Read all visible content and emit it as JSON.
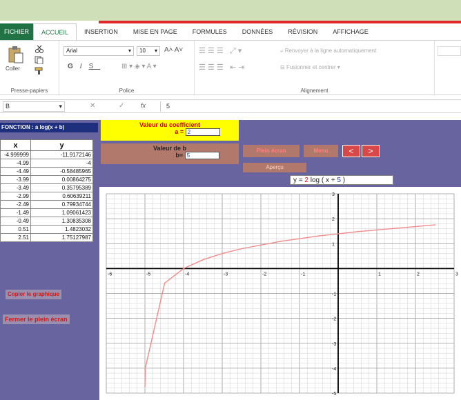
{
  "ribbon": {
    "tabs": [
      "FICHIER",
      "ACCUEIL",
      "INSERTION",
      "MISE EN PAGE",
      "FORMULES",
      "DONNÉES",
      "RÉVISION",
      "AFFICHAGE"
    ],
    "paste_label": "Coller",
    "clipboard_label": "Presse-papiers",
    "font_name": "Arial",
    "font_size": "10",
    "bold": "G",
    "italic": "I",
    "underline": "S",
    "police_label": "Police",
    "wrap_text": "Renvoyer à la ligne automatiquement",
    "merge_center": "Fusionner et centrer",
    "alignment_label": "Alignement"
  },
  "formula_bar": {
    "name_box": "B",
    "fx": "fx",
    "value": "5"
  },
  "sheet": {
    "function_label": "FONCTION : a log(x + b)",
    "table": {
      "headers": [
        "x",
        "y"
      ],
      "rows": [
        [
          "-4.999999",
          "-11.9172146"
        ],
        [
          "-4.99",
          "-4"
        ],
        [
          "-4.49",
          "-0.58485965"
        ],
        [
          "-3.99",
          "0.00864275"
        ],
        [
          "-3.49",
          "0.35795389"
        ],
        [
          "-2.99",
          "0.60639211"
        ],
        [
          "-2.49",
          "0.79934744"
        ],
        [
          "-1.49",
          "1.09061423"
        ],
        [
          "-0.49",
          "1.30835308"
        ],
        [
          "0.51",
          "1.4823032"
        ],
        [
          "2.51",
          "1.75127987"
        ]
      ]
    },
    "copy_graph": "Copier le graphique",
    "close_fullscreen": "Fermer le plein écran",
    "coef_title": "Valeur du coefficient",
    "coef_a_label": "a =",
    "coef_a_value": "2",
    "b_title": "Valeur de b",
    "b_label": "b=",
    "b_value": "5",
    "fullscreen_btn": "Plein écran",
    "menu_btn": "Menu",
    "prev_btn": "<",
    "next_btn": ">",
    "apercu_btn": "Aperçu",
    "equation": {
      "prefix": "y =",
      "a": "2",
      "middle": "log ( x +",
      "b": "5",
      "suffix": ")"
    }
  },
  "chart_data": {
    "type": "line",
    "title": "",
    "xlabel": "",
    "ylabel": "",
    "xlim": [
      -6,
      3
    ],
    "ylim": [
      -5,
      3
    ],
    "grid": true,
    "x_ticks": [
      "-6",
      "-5",
      "-4",
      "-3",
      "-2",
      "-1",
      "1",
      "2",
      "3"
    ],
    "y_ticks": [
      "3",
      "2",
      "1",
      "-1",
      "-2",
      "-3",
      "-4",
      "-5"
    ],
    "series": [
      {
        "color": "#f08a8a",
        "x": [
          -4.999999,
          -4.99,
          -4.49,
          -3.99,
          -3.49,
          -2.99,
          -2.49,
          -1.49,
          -0.49,
          0.51,
          2.51
        ],
        "y": [
          -11.9172146,
          -4,
          -0.58485965,
          0.00864275,
          0.35795389,
          0.60639211,
          0.79934744,
          1.09061423,
          1.30835308,
          1.4823032,
          1.75127987
        ]
      }
    ]
  },
  "colors": {
    "excel_green": "#217346",
    "sheet_bg": "#67649f",
    "curve": "#f08a8a",
    "header_bar": "#1d2f7d",
    "coef_bg": "#ffff00",
    "btn_brown": "#b0796b"
  },
  "icons": [
    "paste-icon",
    "cut-icon",
    "copy-icon",
    "format-painter-icon",
    "dropdown-icon"
  ]
}
